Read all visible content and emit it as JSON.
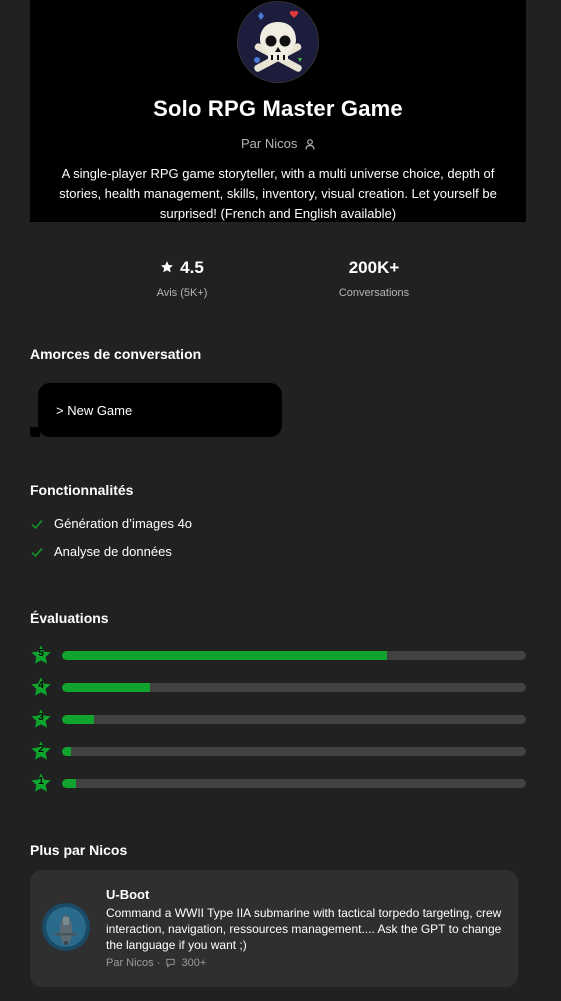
{
  "gpt": {
    "title": "Solo RPG Master Game",
    "byline": "Par Nicos",
    "description": "A single-player RPG game storyteller, with a multi universe choice, depth of stories, health management, skills, inventory, visual creation. Let yourself be surprised! (French and English available)"
  },
  "stats": [
    {
      "value": "4.5",
      "label": "Avis (5K+)",
      "icon": "star-icon"
    },
    {
      "value": "200K+",
      "label": "Conversations"
    }
  ],
  "starters": {
    "title": "Amorces de conversation",
    "items": [
      "> New Game"
    ]
  },
  "features": {
    "title": "Fonctionnalités",
    "items": [
      "Génération d’images 4o",
      "Analyse de données"
    ]
  },
  "ratings": {
    "title": "Évaluations",
    "accent": "#10a32e",
    "rows": [
      {
        "stars": "5",
        "fraction": 0.7
      },
      {
        "stars": "4",
        "fraction": 0.19
      },
      {
        "stars": "3",
        "fraction": 0.07
      },
      {
        "stars": "2",
        "fraction": 0.02
      },
      {
        "stars": "1",
        "fraction": 0.03
      }
    ]
  },
  "more": {
    "title": "Plus par Nicos",
    "items": [
      {
        "name": "U-Boot",
        "description": "Command a WWII Type IIA submarine with tactical torpedo targeting, crew interaction, navigation, ressources management.... Ask the GPT to change the language if you want ;)",
        "author": "Par Nicos",
        "separator": "·",
        "count": "300+"
      }
    ]
  }
}
